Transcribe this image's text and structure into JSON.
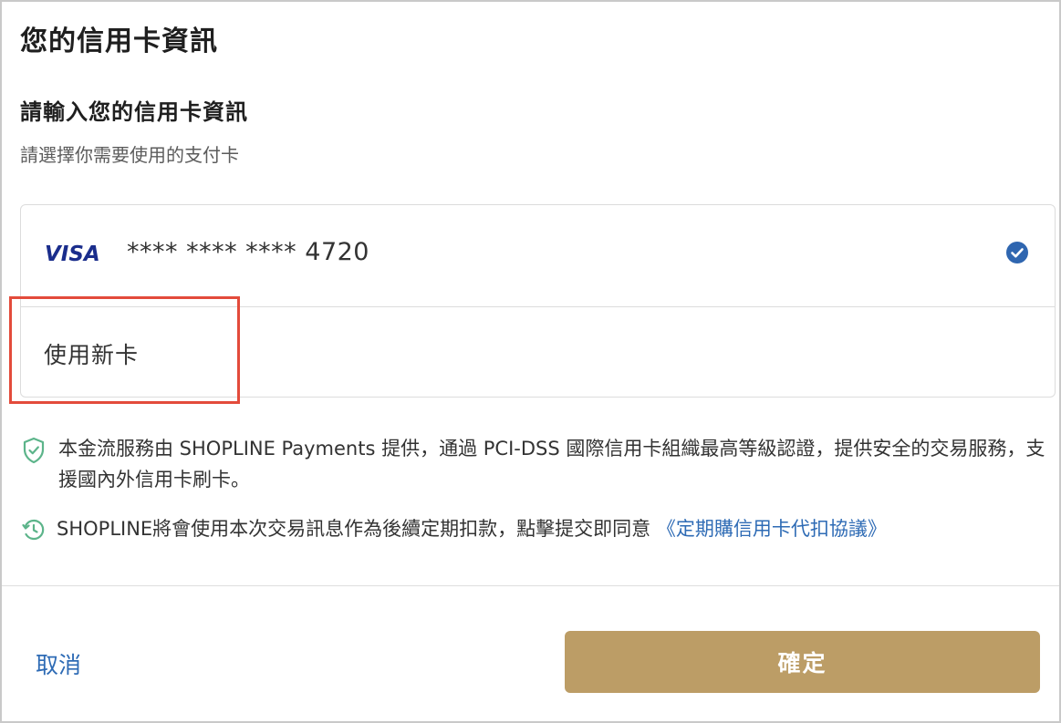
{
  "modal": {
    "title": "您的信用卡資訊",
    "subtitle": "請輸入您的信用卡資訊",
    "hint": "請選擇你需要使用的支付卡"
  },
  "cards": {
    "saved_card": {
      "brand": "VISA",
      "number_mask": "**** **** ****",
      "last4": "4720",
      "selected": true
    },
    "new_card_label": "使用新卡"
  },
  "info": {
    "security_text": "本金流服務由 SHOPLINE Payments 提供，通過 PCI-DSS 國際信用卡組織最高等級認證，提供安全的交易服務，支援國內外信用卡刷卡。",
    "recurring_text": "SHOPLINE將會使用本次交易訊息作為後續定期扣款，點擊提交即同意",
    "agreement_link": "《定期購信用卡代扣協議》"
  },
  "footer": {
    "cancel_label": "取消",
    "confirm_label": "確定"
  },
  "colors": {
    "accent": "#bc9d66",
    "link": "#2e6bb5",
    "highlight": "#e34b3b",
    "check": "#2f66b0",
    "icon_green": "#5cb48a"
  },
  "icons": [
    "visa-logo",
    "check-circle-icon",
    "shield-check-icon",
    "clock-refresh-icon"
  ]
}
